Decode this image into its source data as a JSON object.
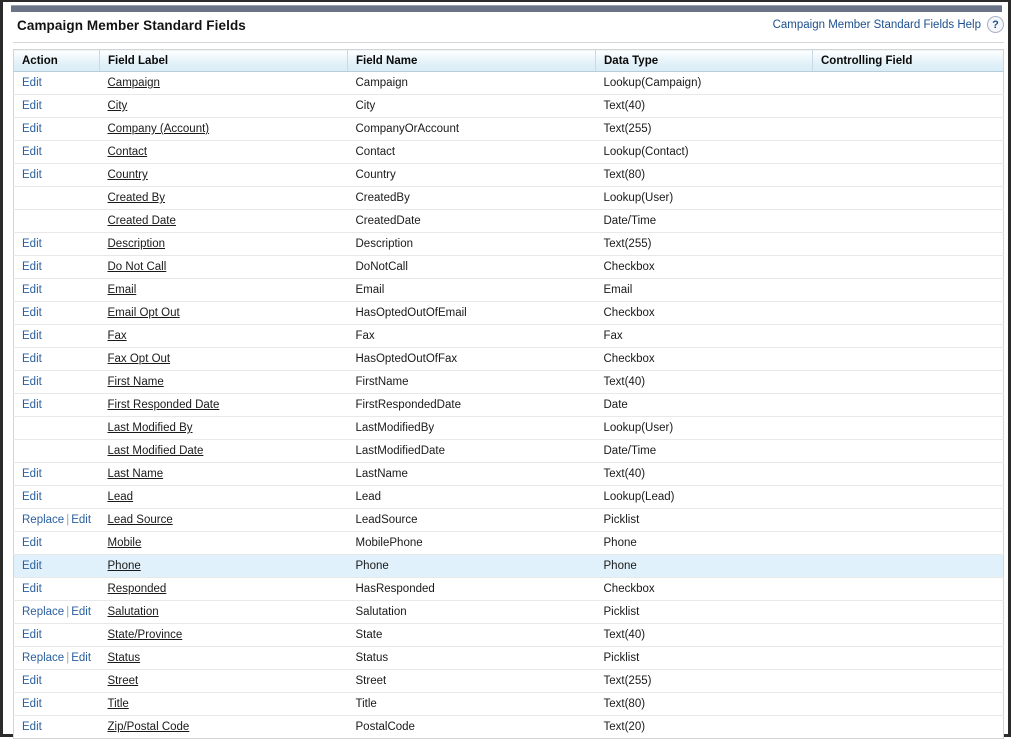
{
  "header": {
    "title": "Campaign Member Standard Fields",
    "help_link": "Campaign Member Standard Fields Help",
    "help_icon": "help-question-icon",
    "help_icon_glyph": "?"
  },
  "table": {
    "columns": [
      "Action",
      "Field Label",
      "Field Name",
      "Data Type",
      "Controlling Field"
    ],
    "action_labels": {
      "edit": "Edit",
      "replace": "Replace",
      "separator": "|"
    },
    "highlighted_row_index": 21,
    "highlight_color": "#e1f1fb",
    "link_color": "#2a5f9e",
    "rows": [
      {
        "actions": [
          "Edit"
        ],
        "label": "Campaign",
        "name": "Campaign",
        "type": "Lookup(Campaign)",
        "controlling": ""
      },
      {
        "actions": [
          "Edit"
        ],
        "label": "City",
        "name": "City",
        "type": "Text(40)",
        "controlling": ""
      },
      {
        "actions": [
          "Edit"
        ],
        "label": "Company (Account)",
        "name": "CompanyOrAccount",
        "type": "Text(255)",
        "controlling": ""
      },
      {
        "actions": [
          "Edit"
        ],
        "label": "Contact",
        "name": "Contact",
        "type": "Lookup(Contact)",
        "controlling": ""
      },
      {
        "actions": [
          "Edit"
        ],
        "label": "Country",
        "name": "Country",
        "type": "Text(80)",
        "controlling": ""
      },
      {
        "actions": [],
        "label": "Created By",
        "name": "CreatedBy",
        "type": "Lookup(User)",
        "controlling": ""
      },
      {
        "actions": [],
        "label": "Created Date",
        "name": "CreatedDate",
        "type": "Date/Time",
        "controlling": ""
      },
      {
        "actions": [
          "Edit"
        ],
        "label": "Description",
        "name": "Description",
        "type": "Text(255)",
        "controlling": ""
      },
      {
        "actions": [
          "Edit"
        ],
        "label": "Do Not Call",
        "name": "DoNotCall",
        "type": "Checkbox",
        "controlling": ""
      },
      {
        "actions": [
          "Edit"
        ],
        "label": "Email",
        "name": "Email",
        "type": "Email",
        "controlling": ""
      },
      {
        "actions": [
          "Edit"
        ],
        "label": "Email Opt Out",
        "name": "HasOptedOutOfEmail",
        "type": "Checkbox",
        "controlling": ""
      },
      {
        "actions": [
          "Edit"
        ],
        "label": "Fax",
        "name": "Fax",
        "type": "Fax",
        "controlling": ""
      },
      {
        "actions": [
          "Edit"
        ],
        "label": "Fax Opt Out",
        "name": "HasOptedOutOfFax",
        "type": "Checkbox",
        "controlling": ""
      },
      {
        "actions": [
          "Edit"
        ],
        "label": "First Name",
        "name": "FirstName",
        "type": "Text(40)",
        "controlling": ""
      },
      {
        "actions": [
          "Edit"
        ],
        "label": "First Responded Date",
        "name": "FirstRespondedDate",
        "type": "Date",
        "controlling": ""
      },
      {
        "actions": [],
        "label": "Last Modified By",
        "name": "LastModifiedBy",
        "type": "Lookup(User)",
        "controlling": ""
      },
      {
        "actions": [],
        "label": "Last Modified Date",
        "name": "LastModifiedDate",
        "type": "Date/Time",
        "controlling": ""
      },
      {
        "actions": [
          "Edit"
        ],
        "label": "Last Name",
        "name": "LastName",
        "type": "Text(40)",
        "controlling": ""
      },
      {
        "actions": [
          "Edit"
        ],
        "label": "Lead",
        "name": "Lead",
        "type": "Lookup(Lead)",
        "controlling": ""
      },
      {
        "actions": [
          "Replace",
          "Edit"
        ],
        "label": "Lead Source",
        "name": "LeadSource",
        "type": "Picklist",
        "controlling": ""
      },
      {
        "actions": [
          "Edit"
        ],
        "label": "Mobile",
        "name": "MobilePhone",
        "type": "Phone",
        "controlling": ""
      },
      {
        "actions": [
          "Edit"
        ],
        "label": "Phone",
        "name": "Phone",
        "type": "Phone",
        "controlling": ""
      },
      {
        "actions": [
          "Edit"
        ],
        "label": "Responded",
        "name": "HasResponded",
        "type": "Checkbox",
        "controlling": ""
      },
      {
        "actions": [
          "Replace",
          "Edit"
        ],
        "label": "Salutation",
        "name": "Salutation",
        "type": "Picklist",
        "controlling": ""
      },
      {
        "actions": [
          "Edit"
        ],
        "label": "State/Province",
        "name": "State",
        "type": "Text(40)",
        "controlling": ""
      },
      {
        "actions": [
          "Replace",
          "Edit"
        ],
        "label": "Status",
        "name": "Status",
        "type": "Picklist",
        "controlling": ""
      },
      {
        "actions": [
          "Edit"
        ],
        "label": "Street",
        "name": "Street",
        "type": "Text(255)",
        "controlling": ""
      },
      {
        "actions": [
          "Edit"
        ],
        "label": "Title",
        "name": "Title",
        "type": "Text(80)",
        "controlling": ""
      },
      {
        "actions": [
          "Edit"
        ],
        "label": "Zip/Postal Code",
        "name": "PostalCode",
        "type": "Text(20)",
        "controlling": ""
      }
    ]
  }
}
